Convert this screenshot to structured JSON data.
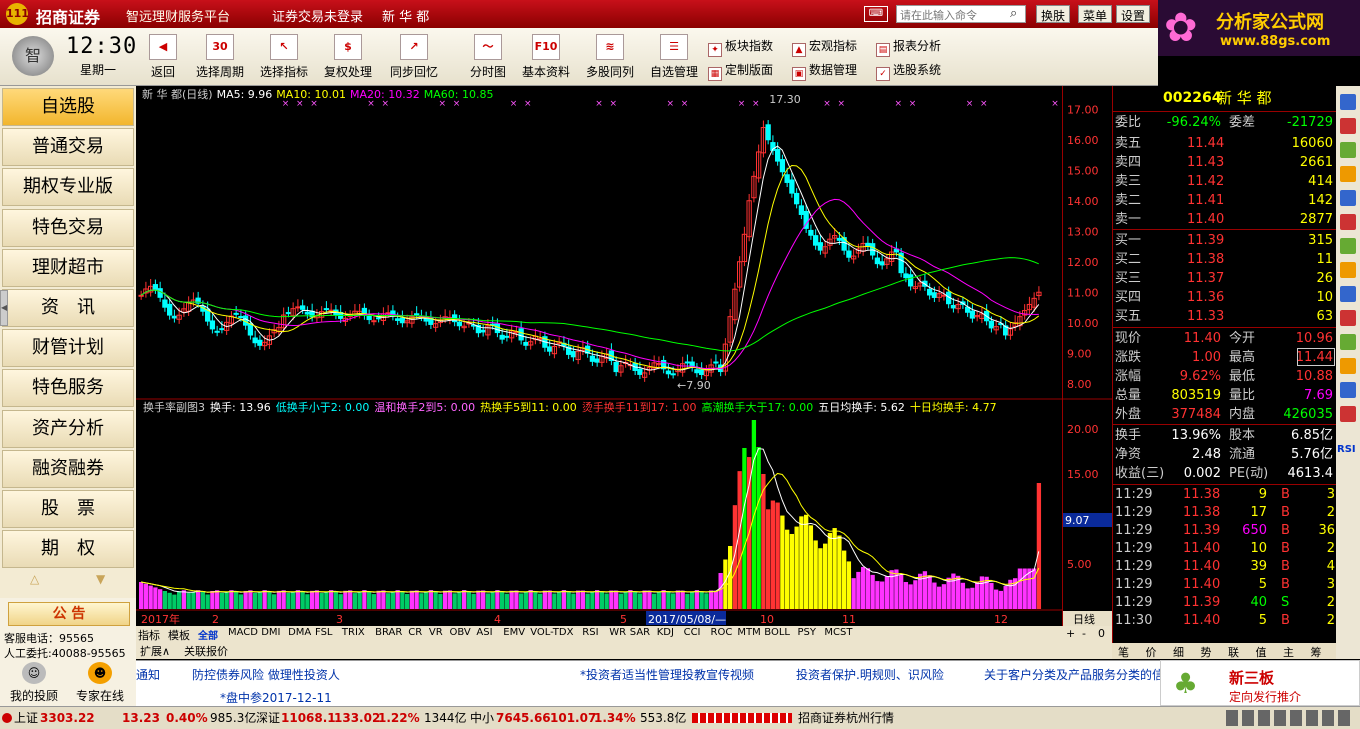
{
  "title": {
    "logo": "111",
    "brand": "招商证券",
    "subtitle": "智远理财服务平台",
    "login": "证券交易未登录",
    "stock": "新 华 都",
    "command_placeholder": "请在此输入命令",
    "buttons": [
      "换肤",
      "菜单",
      "设置"
    ]
  },
  "ad_top": {
    "name": "分析家公式网",
    "url": "www.88gs.com"
  },
  "clock": {
    "time": "12:30",
    "weekday": "星期一",
    "avatar": "智"
  },
  "toolbar": {
    "big": [
      {
        "label": "返回",
        "icon": "back-arrow-icon",
        "glyph": "◀"
      },
      {
        "label": "选择周期",
        "icon": "period-icon",
        "glyph": "30"
      },
      {
        "label": "选择指标",
        "icon": "indicator-cursor-icon",
        "glyph": "↖"
      },
      {
        "label": "复权处理",
        "icon": "rights-adjust-icon",
        "glyph": "$"
      },
      {
        "label": "同步回忆",
        "icon": "sync-chart-icon",
        "glyph": "↗"
      },
      {
        "label": "分时图",
        "icon": "intraday-chart-icon",
        "glyph": "～"
      },
      {
        "label": "基本资料",
        "icon": "f10-icon",
        "glyph": "F10"
      },
      {
        "label": "多股同列",
        "icon": "multi-stock-icon",
        "glyph": "≋"
      },
      {
        "label": "自选管理",
        "icon": "watchlist-icon",
        "glyph": "☰"
      }
    ],
    "small": [
      {
        "label": "板块指数",
        "icon": "sector-index-icon",
        "glyph": "✦"
      },
      {
        "label": "宏观指标",
        "icon": "macro-indicator-icon",
        "glyph": "▲"
      },
      {
        "label": "报表分析",
        "icon": "report-icon",
        "glyph": "▤"
      },
      {
        "label": "定制版面",
        "icon": "custom-layout-icon",
        "glyph": "▦"
      },
      {
        "label": "数据管理",
        "icon": "data-manage-icon",
        "glyph": "▣"
      },
      {
        "label": "选股系统",
        "icon": "stock-picker-icon",
        "glyph": "✓"
      }
    ]
  },
  "sidebar": {
    "items": [
      "自选股",
      "普通交易",
      "期权专业版",
      "特色交易",
      "理财超市",
      "资　讯",
      "财管计划",
      "特色服务",
      "资产分析",
      "融资融券",
      "股　票",
      "期　权"
    ],
    "active": 0,
    "gonggao": "公 告",
    "hotline": "客服电话：95565",
    "manual": "人工委托:40088-95565",
    "my_advisor": "我的投顾",
    "expert": "专家在线"
  },
  "kline": {
    "header": "新 华 都(日线)",
    "ma5": "MA5: 9.96",
    "ma10": "MA10: 10.01",
    "ma20": "MA20: 10.32",
    "ma60": "MA60: 10.85",
    "high_label": "17.30",
    "low_label": "7.90",
    "yticks": [
      "17.00",
      "16.00",
      "15.00",
      "14.00",
      "13.00",
      "12.00",
      "11.00",
      "10.00",
      "9.00",
      "8.00"
    ]
  },
  "turnover": {
    "title": "换手率副图3",
    "hs": "换手: 13.96",
    "low": "低换手小于2: 0.00",
    "mild": "温和换手2到5: 0.00",
    "hot": "热换手5到11: 0.00",
    "vhot": "烫手换手11到17: 1.00",
    "climax": "高潮换手大于17: 0.00",
    "ma5": "五日均换手: 5.62",
    "ma10": "十日均换手: 4.77",
    "yticks": [
      "20.00",
      "15.00",
      "10.00",
      "5.00"
    ],
    "cursor_value": "9.07"
  },
  "time_axis": {
    "labels": [
      "2017年",
      "2",
      "3",
      "4",
      "5",
      "2017/05/08/—",
      "10",
      "11",
      "12"
    ],
    "period": "日线"
  },
  "indicators": [
    "指标",
    "模板",
    "全部",
    "MACD",
    "DMI",
    "DMA",
    "FSL",
    "TRIX",
    "BRAR",
    "CR",
    "VR",
    "OBV",
    "ASI",
    "EMV",
    "VOL-TDX",
    "RSI",
    "WR",
    "SAR",
    "KDJ",
    "CCI",
    "ROC",
    "MTM",
    "BOLL",
    "PSY",
    "MCST"
  ],
  "bottom_tabs": [
    "扩展∧",
    "关联报价"
  ],
  "quote": {
    "code": "002264",
    "name": "新 华 都",
    "weibi_label": "委比",
    "weibi": "-96.24%",
    "weicha_label": "委差",
    "weicha": "-21729",
    "asks": [
      [
        "卖五",
        "11.44",
        "16060"
      ],
      [
        "卖四",
        "11.43",
        "2661"
      ],
      [
        "卖三",
        "11.42",
        "414"
      ],
      [
        "卖二",
        "11.41",
        "142"
      ],
      [
        "卖一",
        "11.40",
        "2877"
      ]
    ],
    "bids": [
      [
        "买一",
        "11.39",
        "315"
      ],
      [
        "买二",
        "11.38",
        "11"
      ],
      [
        "买三",
        "11.37",
        "26"
      ],
      [
        "买四",
        "11.36",
        "10"
      ],
      [
        "买五",
        "11.33",
        "63"
      ]
    ],
    "stats": [
      [
        "现价",
        "11.40",
        "今开",
        "10.96"
      ],
      [
        "涨跌",
        "1.00",
        "最高",
        "11.44"
      ],
      [
        "涨幅",
        "9.62%",
        "最低",
        "10.88"
      ],
      [
        "总量",
        "803519",
        "量比",
        "7.69"
      ],
      [
        "外盘",
        "377484",
        "内盘",
        "426035"
      ]
    ],
    "fund": [
      [
        "换手",
        "13.96%",
        "股本",
        "6.85亿"
      ],
      [
        "净资",
        "2.48",
        "流通",
        "5.76亿"
      ],
      [
        "收益(三)",
        "0.002",
        "PE(动)",
        "4613.4"
      ]
    ],
    "ticks": [
      [
        "11:29",
        "11.38",
        "9",
        "B",
        "3"
      ],
      [
        "11:29",
        "11.38",
        "17",
        "B",
        "2"
      ],
      [
        "11:29",
        "11.39",
        "650",
        "B",
        "36"
      ],
      [
        "11:29",
        "11.40",
        "10",
        "B",
        "2"
      ],
      [
        "11:29",
        "11.40",
        "39",
        "B",
        "4"
      ],
      [
        "11:29",
        "11.40",
        "5",
        "B",
        "3"
      ],
      [
        "11:29",
        "11.39",
        "40",
        "S",
        "2"
      ],
      [
        "11:30",
        "11.40",
        "5",
        "B",
        "2"
      ]
    ],
    "tabs": [
      "笔",
      "价",
      "细",
      "势",
      "联",
      "值",
      "主",
      "筹"
    ]
  },
  "right_strip": [
    "RSI"
  ],
  "news": {
    "items": [
      "通知",
      "防控债券风险 做理性投资人",
      "*投资者适当性管理投教宣传视频",
      "投资者保护.明规则、识风险",
      "关于客户分类及产品服务分类的信"
    ],
    "sub": "*盘中参2017-12-11",
    "ad_title": "新三板",
    "ad_sub": "定向发行推介"
  },
  "status": {
    "sh": "上证",
    "sh_v": "3303.22",
    "sh_c": "13.23",
    "sh_p": "0.40%",
    "sh_a": "985.3亿",
    "sz": "深证",
    "sz_v": "11068.1",
    "sz_c": "133.02",
    "sz_p": "1.22%",
    "sz_a": "1344亿",
    "zx": "中小",
    "zx_v": "7645.66",
    "zx_c": "101.07",
    "zx_p": "1.34%",
    "zx_a": "553.8亿",
    "broker": "招商证券杭州行情"
  },
  "colors": {
    "up": "#ff3232",
    "down": "#00ffff",
    "ma5": "#ffffff",
    "ma10": "#ffff00",
    "ma20": "#ff00ff",
    "ma60": "#00ff00",
    "label": "#cccccc"
  }
}
